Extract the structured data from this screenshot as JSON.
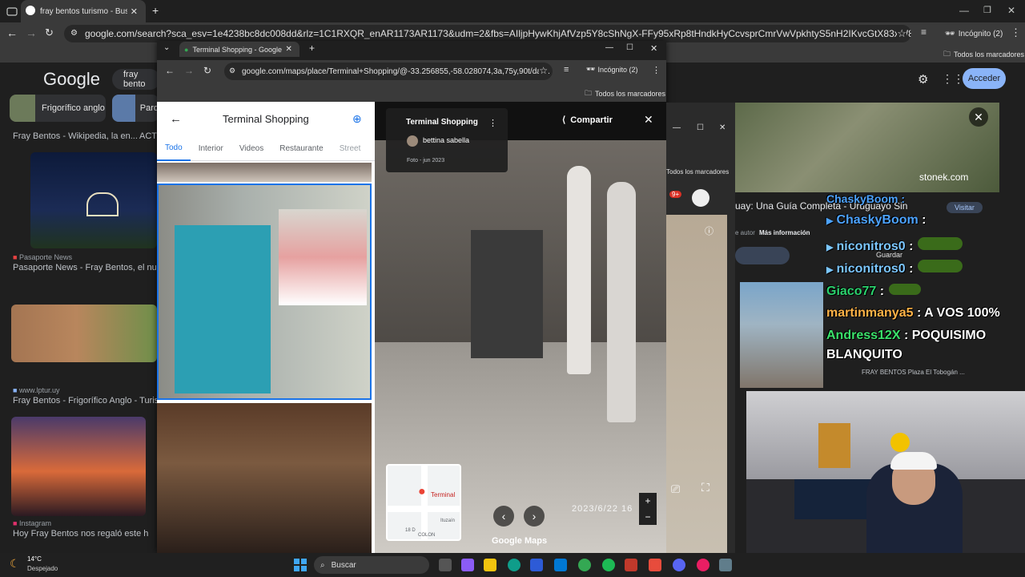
{
  "back_browser": {
    "tab_title": "fray bentos turismo - Buscar con",
    "url": "google.com/search?sca_esv=1e4238bc8dc008dd&rlz=1C1RXQR_enAR1173AR1173&udm=2&fbs=AIljpHywKhjAfVzp5Y8cShNgX-FFy95xRp8tHndkHyCcvsprCmrVwVpkhtyS5nH2IKvcGtX83xW8Nun0pMOR12TSzGLrN0UXtD_RP63MOW-V1eybySqf...",
    "incognito_label": "Incógnito (2)",
    "bookmarks_label": "Todos los marcadores",
    "google_logo": "Google",
    "search_query": "fray bento",
    "signin_button": "Acceder",
    "chips": [
      {
        "label": "Frigorífico anglo"
      },
      {
        "label": "Parq"
      }
    ],
    "results": [
      {
        "caption": "Fray Bentos - Wikipedia, la en...",
        "extra": "ACTI"
      },
      {
        "source": "Pasaporte News",
        "caption": "Pasaporte News - Fray Bentos, el nuevo g"
      },
      {
        "source": "www.lptur.uy",
        "caption": "Fray Bentos - Frigorífico Anglo - Turismo U"
      },
      {
        "source": "Instagram",
        "caption": "Hoy Fray Bentos nos regaló este h..."
      }
    ]
  },
  "front_window": {
    "tab_title": "Terminal Shopping - Google M",
    "url": "google.com/maps/place/Terminal+Shopping/@-33.256855,-58.028074,3a,75y,90t/dat...",
    "incognito_label": "Incógnito (2)",
    "bookmarks_label": "Todos los marcadores",
    "panel_title": "Terminal Shopping",
    "panel_tabs": [
      "Todo",
      "Interior",
      "Videos",
      "Restaurante",
      "Street"
    ],
    "street_view": {
      "place_name": "Terminal Shopping",
      "author": "bettina sabella",
      "photo_date": "Foto - jun 2023",
      "share_label": "Compartir",
      "timestamp": "2023/6/22 16",
      "minimap_label": "Terminal",
      "streets": [
        "18 D",
        "Ituzaín",
        "COLON"
      ],
      "maps_label": "Google Maps"
    }
  },
  "overlay": {
    "article_title": "uay: Una Guía Completa - Uruguayo Sin",
    "visit_button": "Visitar",
    "more_info": "Más información",
    "author_prefix": "e autor",
    "save_label": "Guardar",
    "bookmarks_label": "Todos los marcadores",
    "stonek": "stonek.com",
    "fray_caption": "FRAY BENTOS Plaza El Tobogán ...",
    "chat": [
      {
        "user": "ChaskyBoom",
        "text": " :"
      },
      {
        "user": "niconitros0",
        "text": " :"
      },
      {
        "user": "niconitros0",
        "text": " :"
      },
      {
        "user": "Giaco77",
        "text": " :"
      },
      {
        "user": "martinmanya5",
        "text": " : A VOS 100%"
      },
      {
        "user": "Andress12X",
        "text": " : POQUISIMO"
      },
      {
        "user": "",
        "text": "BLANQUITO"
      }
    ],
    "badge": "9+",
    "colors": {
      "chasky": "#4da3ff",
      "nicon": "#7cc7ff",
      "giaco": "#2bd26e",
      "martin": "#ffb347",
      "andress": "#3be26b"
    }
  },
  "taskbar": {
    "weather_temp": "14°C",
    "weather_desc": "Despejado",
    "search_label": "Buscar"
  }
}
